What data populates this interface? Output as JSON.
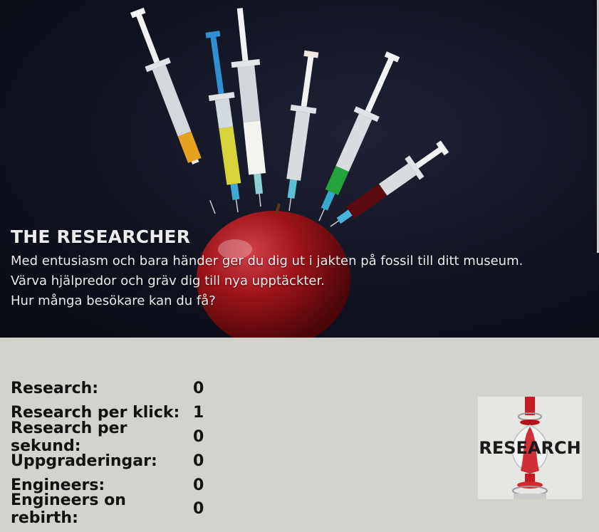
{
  "hero": {
    "title": "THE RESEARCHER",
    "lines": [
      "Med entusiasm och bara händer ger du dig ut i jakten på fossil till ditt museum.",
      "Värva hjälpredor och gräv dig till nya upptäckter.",
      "Hur många besökare kan du få?"
    ]
  },
  "stats": [
    {
      "label": "Research:",
      "value": "0"
    },
    {
      "label": "Research per klick:",
      "value": "1"
    },
    {
      "label": "Research per sekund:",
      "value": "0"
    },
    {
      "label": "Uppgraderingar:",
      "value": "0"
    },
    {
      "label": "Engineers:",
      "value": "0"
    },
    {
      "label": "Engineers on rebirth:",
      "value": "0"
    }
  ],
  "research_button": {
    "label": "RESEARCH"
  },
  "colors": {
    "page_background": "#d1d3cc",
    "hero_background": "#0f121e",
    "apple": "#9e1418",
    "hero_text": "#ececec"
  }
}
